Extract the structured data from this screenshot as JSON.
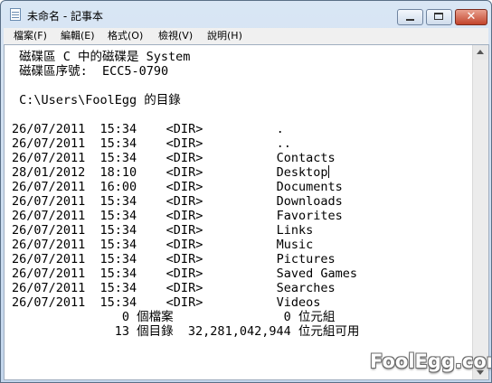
{
  "window": {
    "title": "未命名 - 記事本",
    "app_icon": "notepad-icon",
    "controls": {
      "minimize_icon": "minimize-icon",
      "maximize_icon": "maximize-icon",
      "close_icon": "close-icon",
      "close_glyph": "✕",
      "close_color": "#c2442c"
    }
  },
  "menu": [
    {
      "label": "檔案(F)"
    },
    {
      "label": "編輯(E)"
    },
    {
      "label": "格式(O)"
    },
    {
      "label": "檢視(V)"
    },
    {
      "label": "說明(H)"
    }
  ],
  "document": {
    "lines": [
      " 磁碟區 C 中的磁碟是 System",
      " 磁碟區序號:  ECC5-0790",
      "",
      " C:\\Users\\FoolEgg 的目錄",
      "",
      "26/07/2011  15:34    <DIR>          .",
      "26/07/2011  15:34    <DIR>          ..",
      "26/07/2011  15:34    <DIR>          Contacts",
      "28/01/2012  18:10    <DIR>          Desktop",
      "26/07/2011  16:00    <DIR>          Documents",
      "26/07/2011  15:34    <DIR>          Downloads",
      "26/07/2011  15:34    <DIR>          Favorites",
      "26/07/2011  15:34    <DIR>          Links",
      "26/07/2011  15:34    <DIR>          Music",
      "26/07/2011  15:34    <DIR>          Pictures",
      "26/07/2011  15:34    <DIR>          Saved Games",
      "26/07/2011  15:34    <DIR>          Searches",
      "26/07/2011  15:34    <DIR>          Videos",
      "               0 個檔案               0 位元組",
      "              13 個目錄  32,281,042,944 位元組可用"
    ],
    "cursor_line": 8
  },
  "watermark": "FoolEgg.com"
}
